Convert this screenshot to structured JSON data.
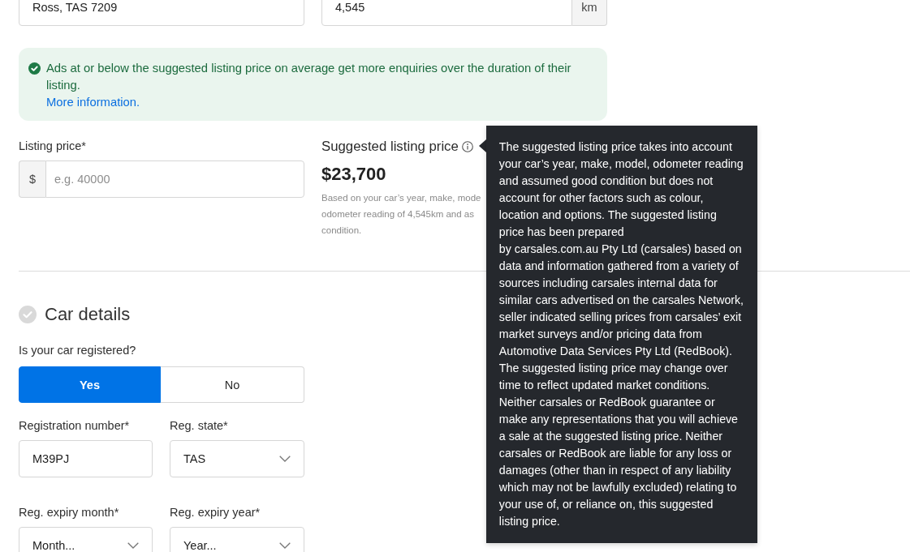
{
  "location_field": {
    "value": "Ross, TAS 7209"
  },
  "odometer_field": {
    "value": "4,545",
    "unit": "km"
  },
  "price_alert": {
    "message": "Ads at or below the suggested listing price on average get more enquiries over the duration of their listing.",
    "link": "More information."
  },
  "listing_price": {
    "label": "Listing price*",
    "prefix": "$",
    "placeholder": "e.g. 40000"
  },
  "suggested_price": {
    "label": "Suggested listing price",
    "amount": "$23,700",
    "note": "Based on your car’s year, make, mode\nodometer reading of 4,545km and as\ncondition.",
    "tooltip": "The suggested listing price takes into account your car’s year, make, model, odometer reading and assumed good condition but does not account for other factors such as colour, location and options. The suggested listing price has been prepared\nby carsales.com.au Pty Ltd (carsales) based on data and information gathered from a variety of sources including carsales internal data for similar cars advertised on the carsales Network, seller indicated selling prices from carsales’ exit market surveys and/or pricing data from Automotive Data Services Pty Ltd (RedBook). The suggested listing price may change over time to reflect updated market conditions. Neither carsales or RedBook guarantee or make any representations that you will achieve a sale at the suggested listing price. Neither carsales or RedBook are liable for any loss or damages (other than in respect of any liability which may not be lawfully excluded) relating to your use of, or reliance on, this suggested listing price."
  },
  "car_details": {
    "title": "Car details",
    "completed": false
  },
  "registered": {
    "label": "Is your car registered?",
    "options": [
      {
        "label": "Yes",
        "selected": true
      },
      {
        "label": "No",
        "selected": false
      }
    ]
  },
  "fields": [
    {
      "kind": "text",
      "label": "Registration number*",
      "value": "M39PJ"
    },
    {
      "kind": "select",
      "label": "Reg. state*",
      "value": "TAS"
    },
    {
      "kind": "select",
      "label": "Reg. expiry month*",
      "value": "Month..."
    },
    {
      "kind": "select",
      "label": "Reg. expiry year*",
      "value": "Year..."
    }
  ]
}
